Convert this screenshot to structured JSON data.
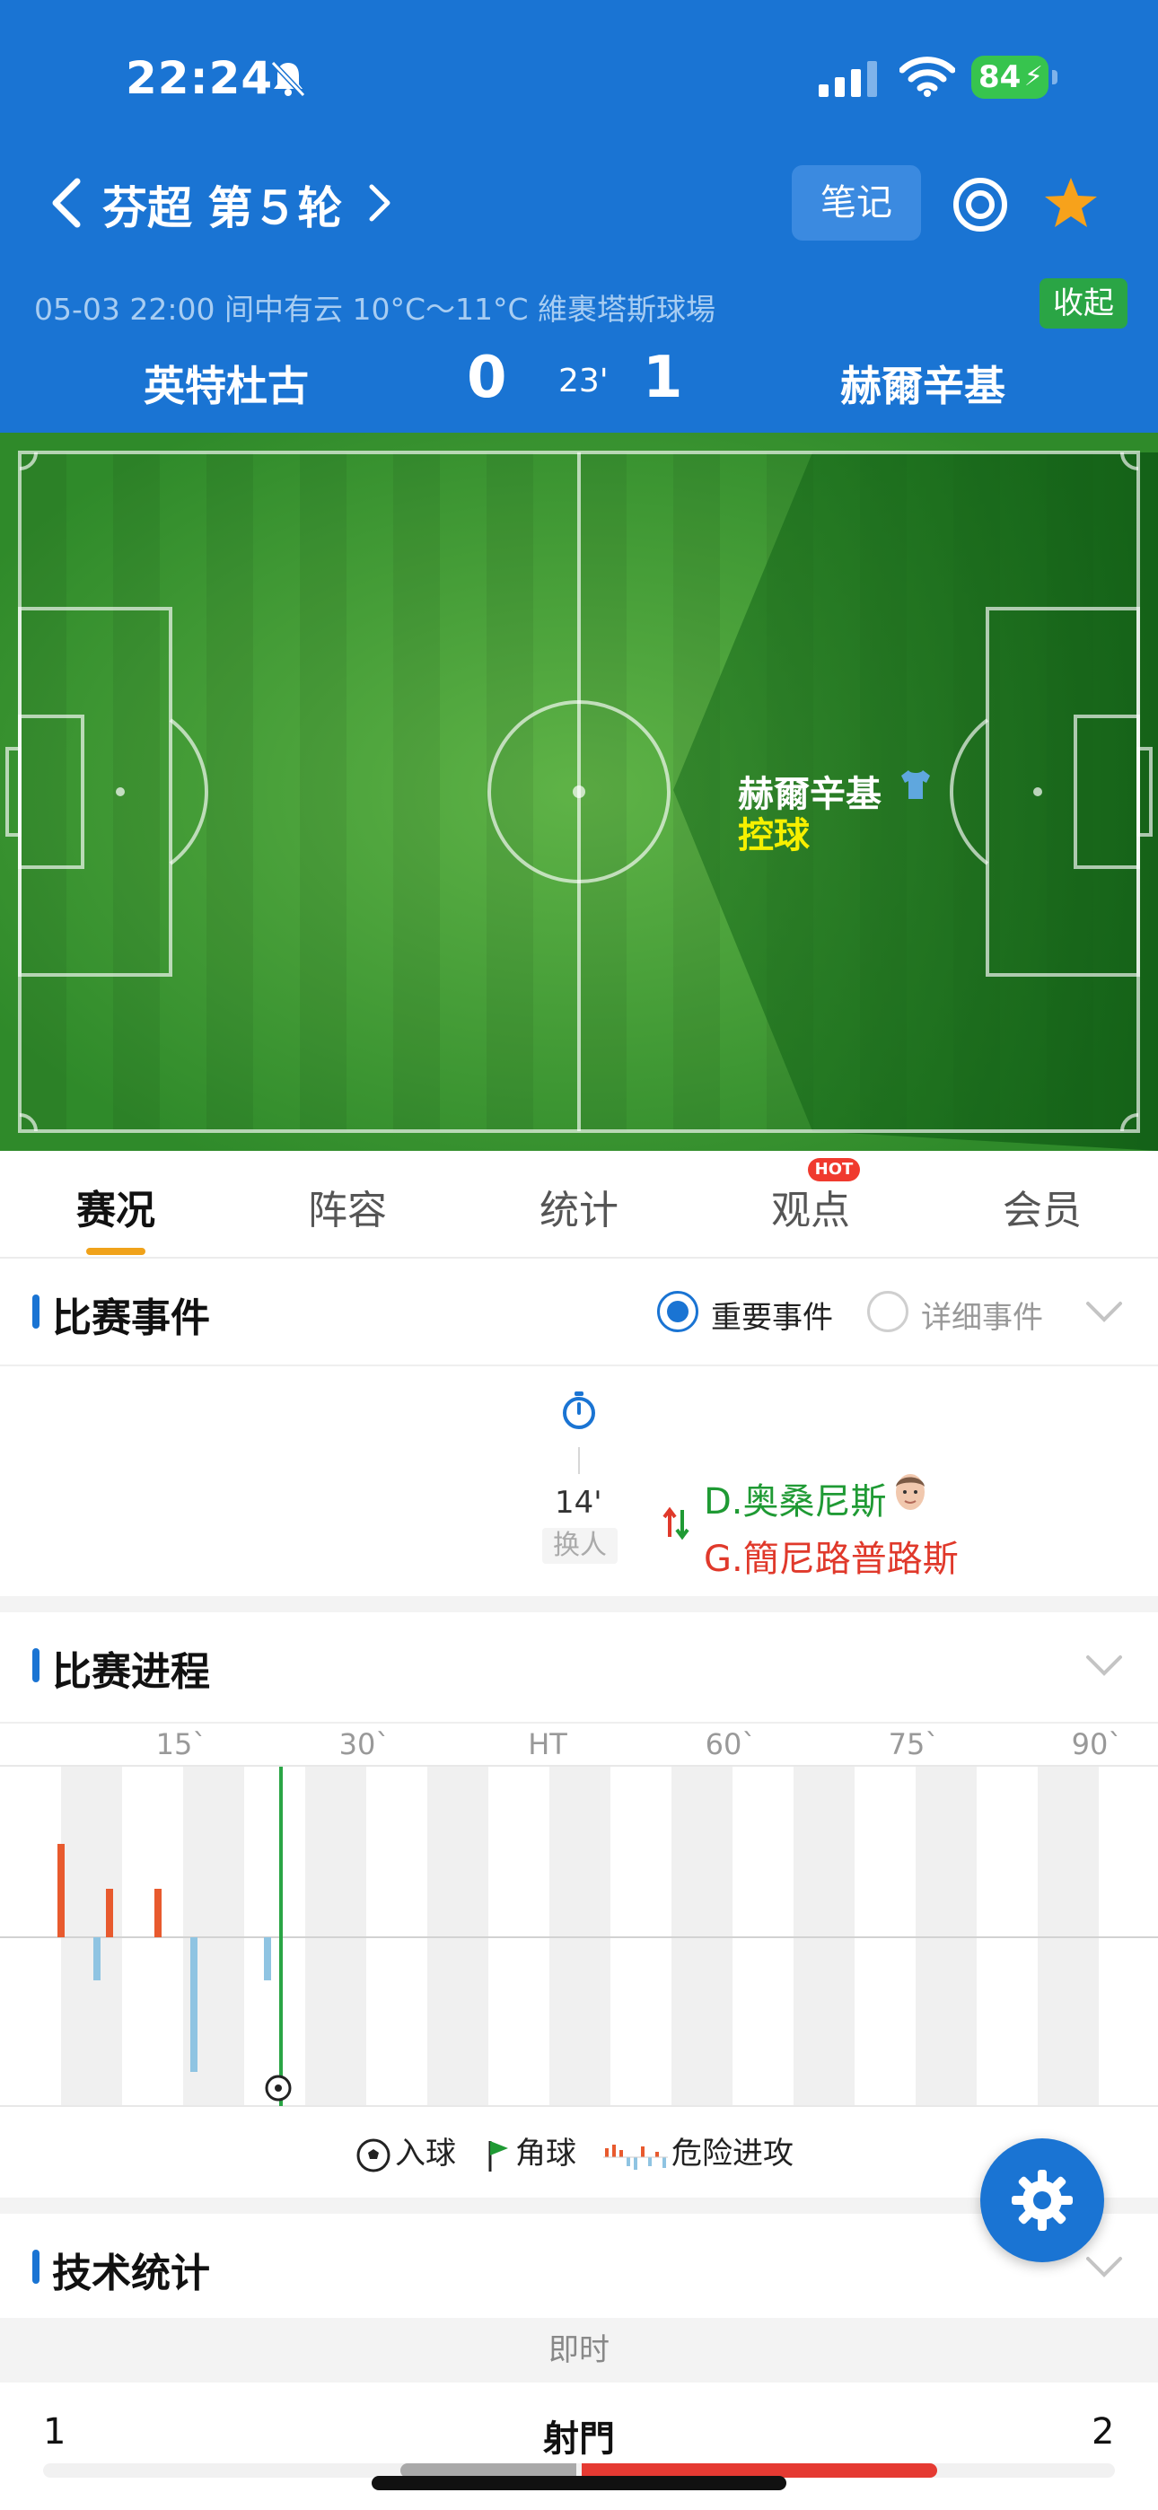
{
  "status_bar": {
    "time": "22:24",
    "battery": "84"
  },
  "header": {
    "league_round": "芬超 第５轮",
    "notes_label": "笔记",
    "match_info": "05-03 22:00   间中有云 10°C～11°C   維裹塔斯球場",
    "collapse_label": "收起"
  },
  "scoreboard": {
    "home_team": "英特杜古",
    "home_score": "0",
    "minute": "23'",
    "away_score": "1",
    "away_team": "赫爾辛基"
  },
  "pitch": {
    "possession_team": "赫爾辛基",
    "possession_label": "控球"
  },
  "tabs": [
    {
      "label": "赛况"
    },
    {
      "label": "阵容"
    },
    {
      "label": "统计"
    },
    {
      "label": "观点",
      "badge": "HOT"
    },
    {
      "label": "会员"
    }
  ],
  "events": {
    "title": "比赛事件",
    "filter_important": "重要事件",
    "filter_detailed": "详细事件",
    "items": [
      {
        "minute": "14'",
        "type": "换人",
        "player_in": "D.奥桑尼斯",
        "player_out": "G.簡尼路普路斯"
      }
    ]
  },
  "progress": {
    "title": "比赛进程",
    "labels": [
      "15`",
      "30`",
      "HT",
      "60`",
      "75`",
      "90`"
    ],
    "legend": {
      "goal": "入球",
      "corner": "角球",
      "danger": "危险进攻"
    }
  },
  "tech_stats": {
    "title": "技术统计",
    "mode": "即时",
    "rows": [
      {
        "name": "射門",
        "home": "1",
        "away": "2",
        "home_fraction": 0.333
      }
    ]
  },
  "colors": {
    "header_bg": "#1a74d3",
    "home_attack": "#e85a2e",
    "away_attack": "#8fc4e2",
    "accent": "#f0a21a"
  }
}
